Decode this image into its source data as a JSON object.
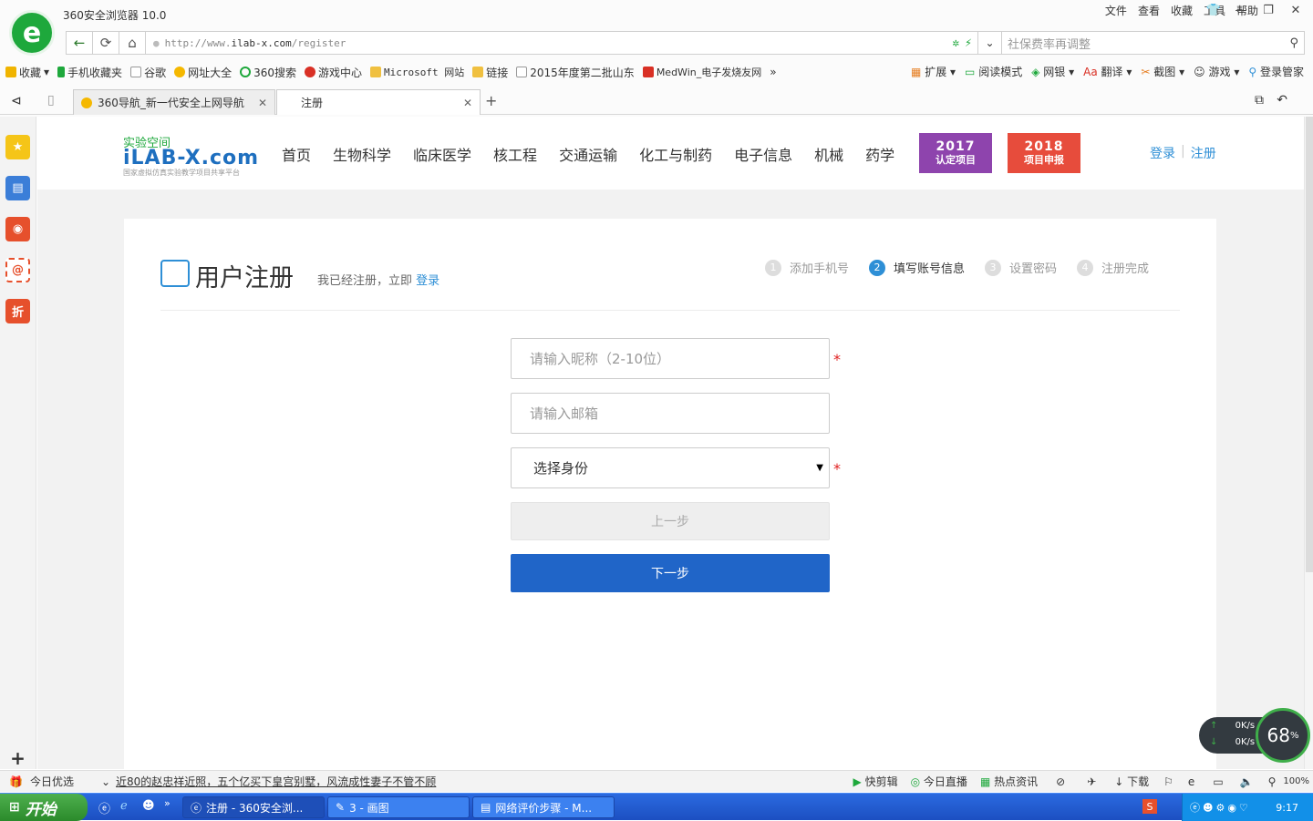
{
  "browser": {
    "title": "360安全浏览器 10.0",
    "menu": [
      "文件",
      "查看",
      "收藏",
      "工具",
      "帮助"
    ],
    "url_prefix": "http://www.",
    "url_host": "ilab-x.com",
    "url_path": "/register",
    "search_placeholder": "社保费率再调整",
    "favorites": [
      {
        "label": "收藏",
        "color": "#f0b400"
      },
      {
        "label": "手机收藏夹",
        "color": "#1ea83c"
      },
      {
        "label": "谷歌",
        "color": "#bbbbbb"
      },
      {
        "label": "网址大全",
        "color": "#f5b800"
      },
      {
        "label": "360搜索",
        "color": "#1ea83c"
      },
      {
        "label": "游戏中心",
        "color": "#d93025"
      },
      {
        "label": "Microsoft 网站",
        "color": "#f0c040"
      },
      {
        "label": "链接",
        "color": "#f0c040"
      },
      {
        "label": "2015年度第二批山东",
        "color": "#bbbbbb"
      },
      {
        "label": "MedWin_电子发烧友网",
        "color": "#d93025"
      }
    ],
    "toolbar_right": [
      "扩展",
      "阅读模式",
      "网银",
      "翻译",
      "截图",
      "游戏",
      "登录管家"
    ],
    "tabs": [
      {
        "label": "360导航_新一代安全上网导航",
        "active": false
      },
      {
        "label": "注册",
        "active": true
      }
    ]
  },
  "site": {
    "logo_cn": "实验空间",
    "logo_en": "iLAB-X.com",
    "logo_sub": "国家虚拟仿真实验教学项目共享平台",
    "nav": [
      "首页",
      "生物科学",
      "临床医学",
      "核工程",
      "交通运输",
      "化工与制药",
      "电子信息",
      "机械",
      "药学"
    ],
    "banner_2017": {
      "year": "2017",
      "text": "认定项目",
      "color": "#8e44ad"
    },
    "banner_2018": {
      "year": "2018",
      "text": "项目申报",
      "color": "#e74c3c"
    },
    "login": "登录",
    "separator": "|",
    "register": "注册"
  },
  "form": {
    "title": "用户注册",
    "subtitle": "我已经注册，立即",
    "login_link": "登录",
    "steps": [
      {
        "num": "1",
        "label": "添加手机号",
        "current": false
      },
      {
        "num": "2",
        "label": "填写账号信息",
        "current": true
      },
      {
        "num": "3",
        "label": "设置密码",
        "current": false
      },
      {
        "num": "4",
        "label": "注册完成",
        "current": false
      }
    ],
    "nickname_placeholder": "请输入昵称（2-10位）",
    "email_placeholder": "请输入邮箱",
    "identity_selected": "选择身份",
    "required_mark": "*",
    "prev_button": "上一步",
    "next_button": "下一步"
  },
  "speed_widget": {
    "up": "0K/s",
    "down": "0K/s",
    "percent": "68",
    "percent_unit": "%"
  },
  "status_bar": {
    "today_pick": "今日优选",
    "headline": "近80的赵忠祥近照，五个亿买下皇宫别墅，风流成性妻子不管不顾",
    "items": [
      "快剪辑",
      "今日直播",
      "热点资讯",
      "下载"
    ],
    "zoom": "100%"
  },
  "taskbar": {
    "start": "开始",
    "tasks": [
      "注册 - 360安全浏...",
      "3 - 画图",
      "网络评价步骤 - M..."
    ],
    "clock": "9:17"
  }
}
